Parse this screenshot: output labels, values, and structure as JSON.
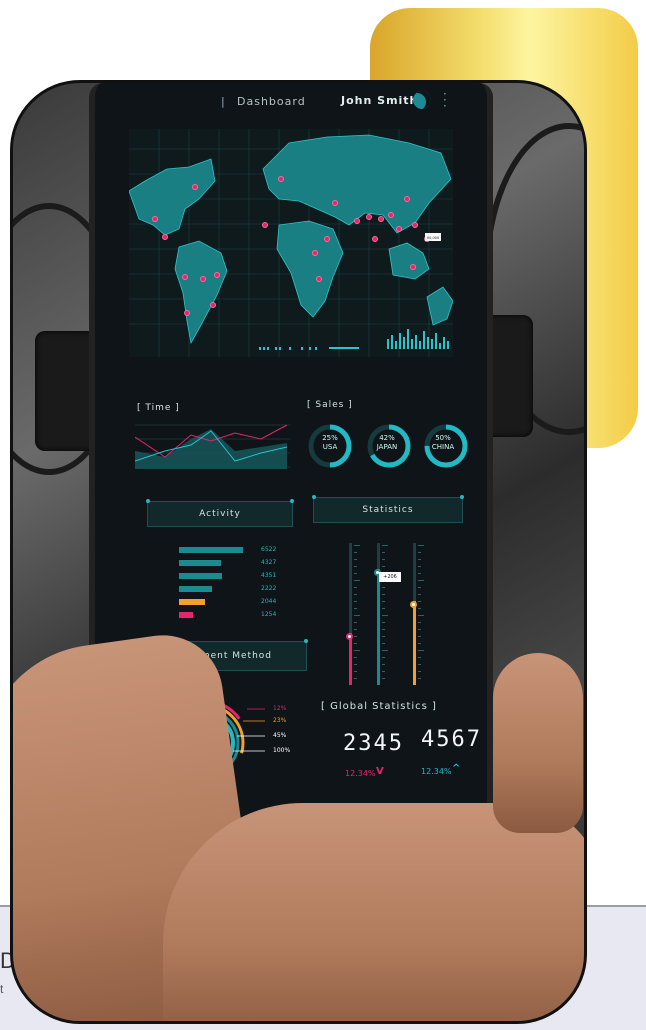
{
  "phone": {
    "topbar": {
      "separator": "|",
      "title": "Dashboard",
      "user_name": "John Smith"
    },
    "map": {
      "tooltip": "00,000"
    },
    "time_section": {
      "label": "[ Time ]"
    },
    "sales_section": {
      "label": "[ Sales ]",
      "donuts": [
        {
          "pct": "25%",
          "country": "USA",
          "value": 25
        },
        {
          "pct": "42%",
          "country": "JAPAN",
          "value": 42
        },
        {
          "pct": "50%",
          "country": "CHINA",
          "value": 50
        }
      ]
    },
    "activity": {
      "label": "Activity",
      "bars": [
        {
          "value": "6522",
          "color": "#1a8b8f",
          "level": 1.0
        },
        {
          "value": "4327",
          "color": "#1a8b8f",
          "level": 0.66
        },
        {
          "value": "4351",
          "color": "#1a8b8f",
          "level": 0.67
        },
        {
          "value": "2222",
          "color": "#1a8b8f",
          "level": 0.52
        },
        {
          "value": "2044",
          "color": "#f2a02b",
          "level": 0.4
        },
        {
          "value": "1254",
          "color": "#e0286b",
          "level": 0.22
        }
      ]
    },
    "statistics": {
      "label": "Statistics",
      "slider_tag": "+206"
    },
    "payment": {
      "label": "Payment Method",
      "legend": [
        {
          "value": "12%",
          "color": "#e0286b"
        },
        {
          "value": "23%",
          "color": "#f2a02b"
        },
        {
          "value": "45%",
          "color": "#ffffff"
        },
        {
          "value": "100%",
          "color": "#ffffff"
        }
      ]
    },
    "global": {
      "label": "[ Global Statistics ]",
      "left_value": "2345",
      "left_change": "12.34%",
      "right_value": "4567",
      "right_change": "12.34%"
    }
  },
  "background": {
    "text_fragment": "DA",
    "sub_fragment": "t"
  },
  "colors": {
    "accent": "#22b8c4",
    "pink": "#e0286b",
    "orange": "#f2a02b",
    "gold": "#f3dc6a"
  }
}
